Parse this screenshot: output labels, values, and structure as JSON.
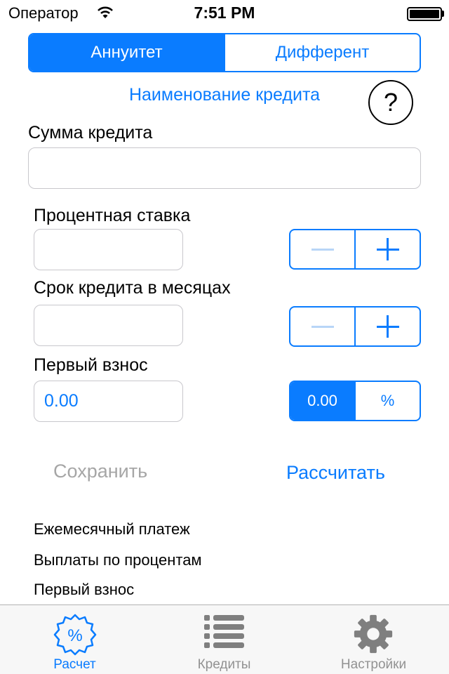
{
  "status_bar": {
    "carrier": "Оператор",
    "time": "7:51 PM"
  },
  "mode_segment": {
    "items": [
      "Аннуитет",
      "Дифферент"
    ],
    "selected": "Аннуитет"
  },
  "credit_name_link": "Наименование кредита",
  "help_button": "?",
  "loan_amount": {
    "label": "Сумма кредита",
    "value": ""
  },
  "interest_rate": {
    "label": "Процентная ставка",
    "value": ""
  },
  "term_months": {
    "label": "Срок кредита в месяцах",
    "value": ""
  },
  "down_payment": {
    "label": "Первый взнос",
    "value": "0.00",
    "unit_segment": {
      "items": [
        "0.00",
        "%"
      ],
      "selected": "0.00"
    }
  },
  "actions": {
    "save": "Сохранить",
    "calculate": "Рассчитать"
  },
  "results": [
    "Ежемесячный платеж",
    "Выплаты по процентам",
    "Первый взнос"
  ],
  "tab_bar": {
    "items": [
      {
        "label": "Расчет",
        "icon": "percent-badge-icon",
        "active": true
      },
      {
        "label": "Кредиты",
        "icon": "list-icon",
        "active": false
      },
      {
        "label": "Настройки",
        "icon": "gear-icon",
        "active": false
      }
    ]
  },
  "colors": {
    "accent": "#0a7cff",
    "disabled_text": "#a6a6a6",
    "inactive_tab": "#929292"
  }
}
